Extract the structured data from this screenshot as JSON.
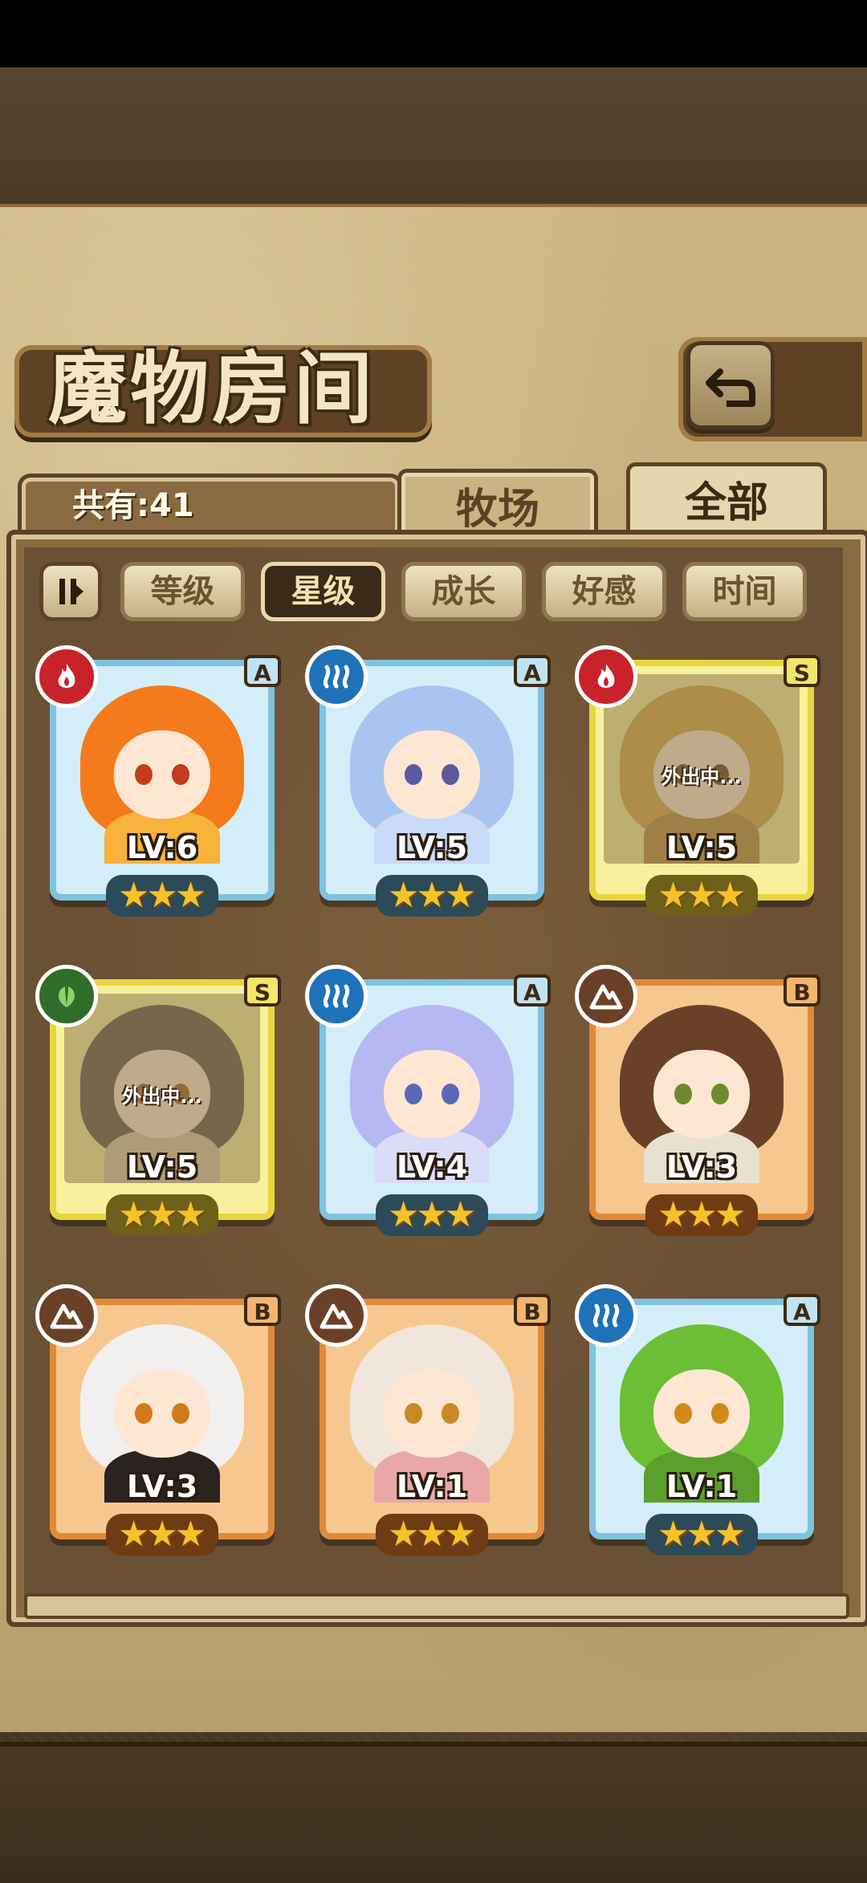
{
  "title": "魔物房间",
  "count_text": "共有:41",
  "tabs": {
    "ranch": "牧场",
    "all": "全部"
  },
  "sort": [
    "等级",
    "星级",
    "成长",
    "好感",
    "时间"
  ],
  "active_sort": "星级",
  "colors": {
    "rank_A": "#7ec3e0",
    "rank_S": "#e8d640",
    "rank_B": "#e08a3a",
    "star": "#f5c22a",
    "fire": "#c8232b",
    "water": "#1e72b8",
    "leaf": "#2f6d2a",
    "earth": "#6a4128"
  },
  "monsters": [
    {
      "level": "LV:6",
      "rank": "A",
      "element": "fire",
      "stars": 3,
      "away": "",
      "hair": "#f47a1c",
      "body": "#f7b23a",
      "eye": "#c23b1c"
    },
    {
      "level": "LV:5",
      "rank": "A",
      "element": "water",
      "stars": 3,
      "away": "",
      "hair": "#a9c4f0",
      "body": "#c8daf7",
      "eye": "#5a5a9e"
    },
    {
      "level": "LV:5",
      "rank": "S",
      "element": "fire",
      "stars": 3,
      "away": "外出中...",
      "hair": "#d6a63e",
      "body": "#b38a3a",
      "eye": "#5c3a10"
    },
    {
      "level": "LV:5",
      "rank": "S",
      "element": "leaf",
      "stars": 3,
      "away": "外出中...",
      "hair": "#5a5048",
      "body": "#d8c8a8",
      "eye": "#9a5a1e"
    },
    {
      "level": "LV:4",
      "rank": "A",
      "element": "water",
      "stars": 3,
      "away": "",
      "hair": "#b6b8f2",
      "body": "#dadcf8",
      "eye": "#5a68b8"
    },
    {
      "level": "LV:3",
      "rank": "B",
      "element": "earth",
      "stars": 3,
      "away": "",
      "hair": "#6a4128",
      "body": "#e9e1cf",
      "eye": "#6f8a2c"
    },
    {
      "level": "LV:3",
      "rank": "B",
      "element": "earth",
      "stars": 3,
      "away": "",
      "hair": "#f2f0ee",
      "body": "#2b2320",
      "eye": "#d07a1a"
    },
    {
      "level": "LV:1",
      "rank": "B",
      "element": "earth",
      "stars": 3,
      "away": "",
      "hair": "#f1e6dc",
      "body": "#e8a8a8",
      "eye": "#c98a24"
    },
    {
      "level": "LV:1",
      "rank": "A",
      "element": "water",
      "stars": 3,
      "away": "",
      "hair": "#6cbf34",
      "body": "#5b9e2c",
      "eye": "#d08a1a"
    }
  ]
}
